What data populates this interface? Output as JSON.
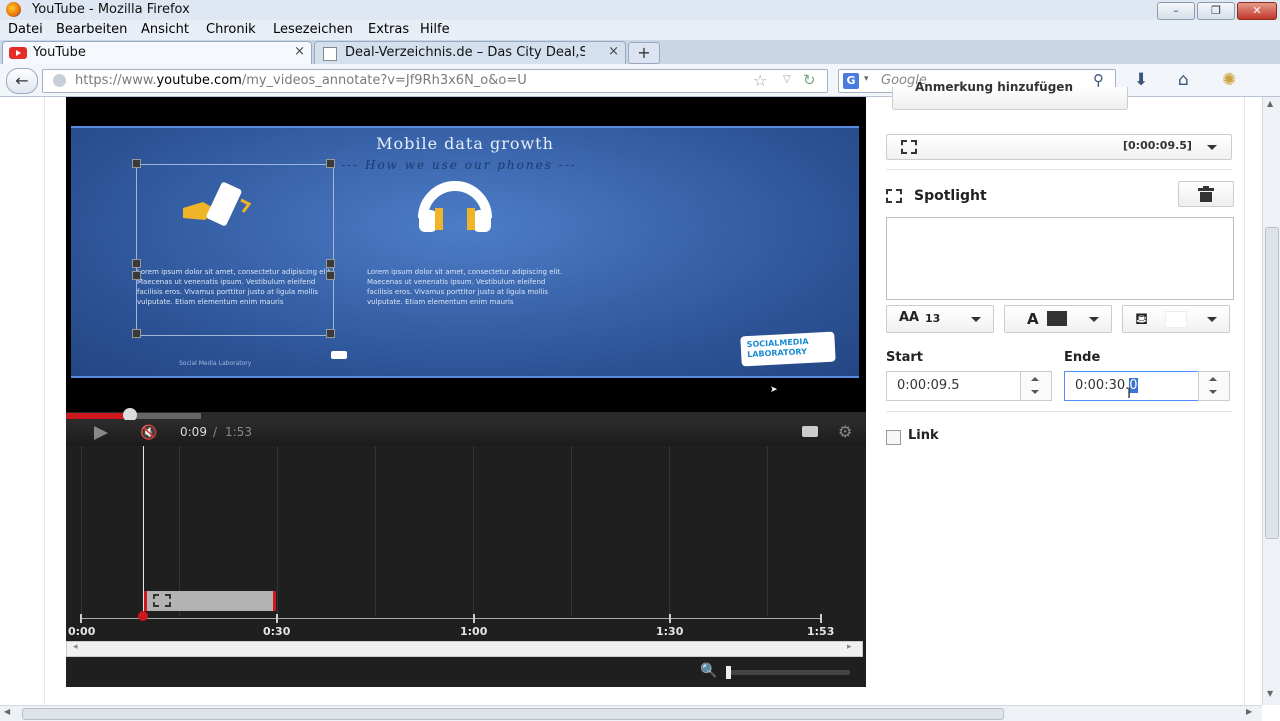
{
  "window": {
    "title": "YouTube - Mozilla Firefox",
    "minimize": "–",
    "restore": "❐",
    "close": "✕"
  },
  "menu": [
    "Datei",
    "Bearbeiten",
    "Ansicht",
    "Chronik",
    "Lesezeichen",
    "Extras",
    "Hilfe"
  ],
  "tabs": [
    {
      "label": "YouTube",
      "close": "×"
    },
    {
      "label": "Deal-Verzeichnis.de – Das City Deal,S...",
      "close": "×"
    }
  ],
  "new_tab": "+",
  "nav": {
    "back": "←",
    "url_prefix": "https://www.",
    "url_domain": "youtube.com",
    "url_path": "/my_videos_annotate?v=Jf9Rh3x6N_o&o=U",
    "search_engine": "G",
    "search_placeholder": "Google"
  },
  "video": {
    "slide_title": "Mobile  data  growth",
    "slide_subtitle": "--- How  we  use  our  phones ---",
    "lorem_1": "Lorem ipsum dolor sit amet, consectetur adipiscing elit. Maecenas ut venenatis ipsum. Vestibulum eleifend facilisis eros. Vivamus porttitor justo at ligula mollis vulputate. Etiam elementum enim mauris",
    "lorem_2": "Lorem ipsum dolor sit amet, consectetur adipiscing elit. Maecenas ut venenatis ipsum. Vestibulum eleifend facilisis eros. Vivamus porttitor justo at ligula mollis vulputate. Etiam elementum enim mauris",
    "footer": "Social  Media  Laboratory",
    "logo_line1": "SOCIALMEDIA",
    "logo_line2": "LABORATORY",
    "progress_fraction": 0.08
  },
  "controls": {
    "time_current": "0:09",
    "time_sep": "/",
    "time_duration": "1:53"
  },
  "timeline": {
    "labels": [
      "0:00",
      "0:30",
      "1:00",
      "1:30",
      "1:53"
    ]
  },
  "panel": {
    "add_annotation": "Anmerkung hinzufügen",
    "annotation_time": "[0:00:09.5]",
    "annotation_type": "Spotlight",
    "font_size": "13",
    "start_label": "Start",
    "start_value": "0:00:09.5",
    "end_label": "Ende",
    "end_value_plain": "0:00:30.",
    "end_value_selected": "0",
    "link_label": "Link"
  },
  "colors": {
    "accent_red": "#cc181e",
    "slide_blue": "#2c5396",
    "focus_blue": "#4d90fe"
  }
}
